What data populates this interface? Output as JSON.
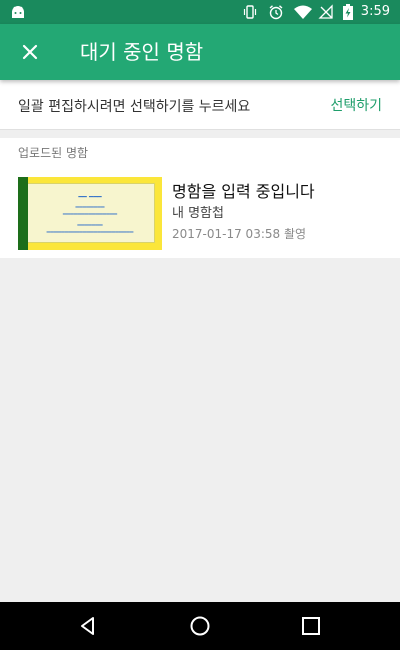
{
  "status_bar": {
    "time": "3:59",
    "icons": [
      "android-icon",
      "vibrate-icon",
      "alarm-icon",
      "wifi-icon",
      "no-signal-icon",
      "battery-charging-icon"
    ]
  },
  "app_bar": {
    "title": "대기 중인 명함",
    "close_icon": "close-icon"
  },
  "batch_bar": {
    "hint": "일괄 편집하시려면 선택하기를 누르세요",
    "select_label": "선택하기"
  },
  "section": {
    "label": "업로드된 명함"
  },
  "cards": [
    {
      "title": "명함을 입력 중입니다",
      "folder": "내 명함첩",
      "date": "2017-01-17 03:58 촬영"
    }
  ],
  "nav": {
    "icons": [
      "back-icon",
      "home-icon",
      "recents-icon"
    ]
  },
  "colors": {
    "status_bar": "#1a8a5d",
    "app_bar": "#23a874",
    "accent": "#1f9e6b",
    "nav_bar": "#000000"
  }
}
